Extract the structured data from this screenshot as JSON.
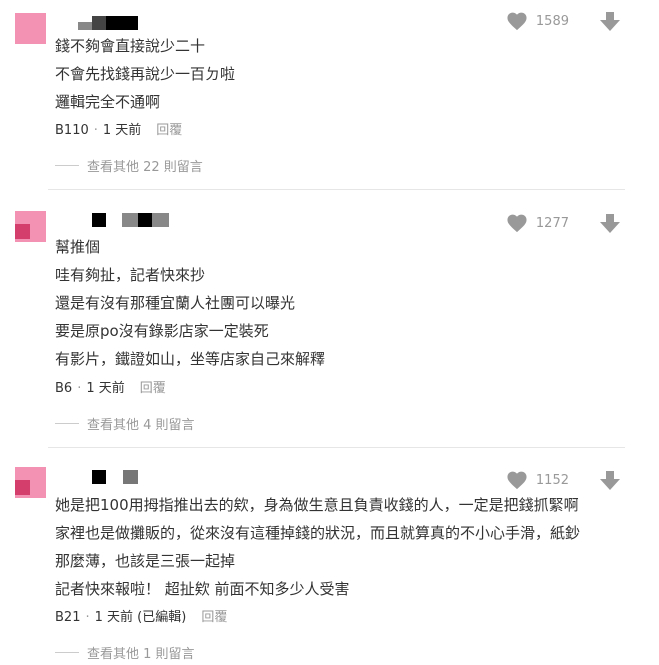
{
  "colors": {
    "avatar_pink": "#f392b3",
    "avatar_dark_pink": "#d33e6d",
    "icon_gray": "#999999",
    "text": "#333333"
  },
  "comments": [
    {
      "likes": "1589",
      "lines": [
        "錢不夠會直接說少二十",
        "不會先找錢再說少一百ㄉ啦",
        "邏輯完全不通啊"
      ],
      "floor": "B110",
      "time": "1 天前",
      "edited": "",
      "reply_label": "回覆",
      "more_replies": "查看其他 22 則留言"
    },
    {
      "likes": "1277",
      "lines": [
        "幫推個",
        "哇有夠扯，記者快來抄",
        "還是有沒有那種宜蘭人社團可以曝光",
        "要是原po沒有錄影店家一定裝死",
        "有影片，鐵證如山，坐等店家自己來解釋"
      ],
      "floor": "B6",
      "time": "1 天前",
      "edited": "",
      "reply_label": "回覆",
      "more_replies": "查看其他 4 則留言"
    },
    {
      "likes": "1152",
      "lines": [
        "她是把100用拇指推出去的欸，身為做生意且負責收錢的人，一定是把錢抓緊啊",
        "家裡也是做攤販的，從來沒有這種掉錢的狀況，而且就算真的不小心手滑，紙鈔",
        "那麼薄，也該是三張一起掉",
        "記者快來報啦！ 超扯欸 前面不知多少人受害"
      ],
      "floor": "B21",
      "time": "1 天前",
      "edited": "(已編輯)",
      "reply_label": "回覆",
      "more_replies": "查看其他 1 則留言"
    }
  ],
  "icons": {
    "like": "heart-icon",
    "dislike": "down-arrow-icon"
  }
}
